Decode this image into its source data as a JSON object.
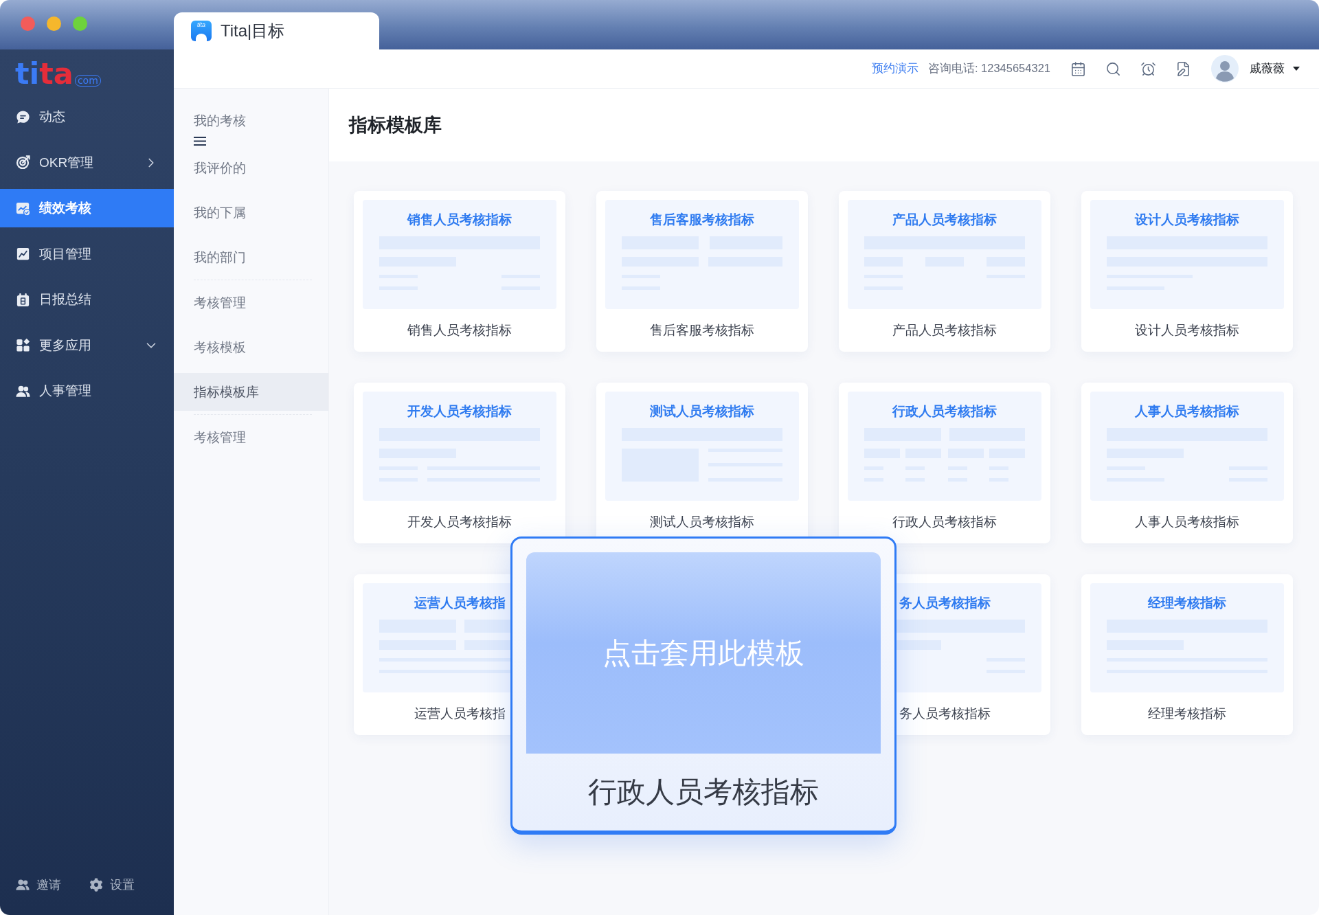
{
  "window_controls": [
    {
      "color": "#f25c5a"
    },
    {
      "color": "#f5b72c"
    },
    {
      "color": "#6ed23c"
    }
  ],
  "tabs": [
    {
      "icon_text": "tita",
      "title": "Tita|目标",
      "selected": true
    }
  ],
  "sidebar": {
    "logo": {
      "parts": [
        {
          "text": "ti",
          "color": "#3b7bf6"
        },
        {
          "text": "ta",
          "color": "#e52d3a"
        }
      ],
      "suffix": "com"
    },
    "items": [
      {
        "kind": "link",
        "label": "动态",
        "selected": false
      },
      {
        "kind": "flyout",
        "label": "OKR管理",
        "selected": false
      },
      {
        "kind": "link",
        "label": "绩效考核",
        "selected": true
      },
      {
        "kind": "link",
        "label": "项目管理",
        "selected": false
      },
      {
        "kind": "link",
        "label": "日报总结",
        "selected": false
      },
      {
        "kind": "dropdown",
        "label": "更多应用",
        "selected": false
      },
      {
        "kind": "link",
        "label": "人事管理",
        "selected": false
      }
    ],
    "footer": [
      {
        "kind": "invite",
        "label": "邀请"
      },
      {
        "kind": "settings",
        "label": "设置"
      }
    ]
  },
  "topbar": {
    "demo_link": "预约演示",
    "phone": "咨询电话: 12345654321",
    "user": {
      "name": "戚薇薇"
    }
  },
  "submenu": {
    "groups": [
      {
        "items": [
          {
            "kind": "heading",
            "label": "我的考核",
            "selected": false
          },
          {
            "label": "我评价的",
            "selected": false
          },
          {
            "label": "我的下属",
            "selected": false
          },
          {
            "label": "我的部门",
            "selected": false
          }
        ]
      },
      {
        "items": [
          {
            "label": "考核管理",
            "selected": false
          },
          {
            "label": "考核模板",
            "selected": false
          },
          {
            "label": "指标模板库",
            "selected": true
          }
        ]
      },
      {
        "items": [
          {
            "label": "考核管理",
            "selected": false
          }
        ]
      }
    ]
  },
  "page": {
    "title": "指标模板库",
    "templates": [
      {
        "title": "销售人员考核指标",
        "label": "销售人员考核指标"
      },
      {
        "title": "售后客服考核指标",
        "label": "售后客服考核指标"
      },
      {
        "title": "产品人员考核指标",
        "label": "产品人员考核指标"
      },
      {
        "title": "设计人员考核指标",
        "label": "设计人员考核指标"
      },
      {
        "title": "开发人员考核指标",
        "label": "开发人员考核指标"
      },
      {
        "title": "测试人员考核指标",
        "label": "测试人员考核指标"
      },
      {
        "title": "行政人员考核指标",
        "label": "行政人员考核指标"
      },
      {
        "title": "人事人员考核指标",
        "label": "人事人员考核指标"
      },
      {
        "title": "运营人员考核指",
        "label": "运营人员考核指"
      },
      {
        "title": "务人员考核指标",
        "label": "务人员考核指标"
      },
      {
        "title": "经理考核指标",
        "label": "经理考核指标"
      }
    ],
    "hover_card": {
      "action": "点击套用此模板",
      "label": "行政人员考核指标"
    }
  }
}
